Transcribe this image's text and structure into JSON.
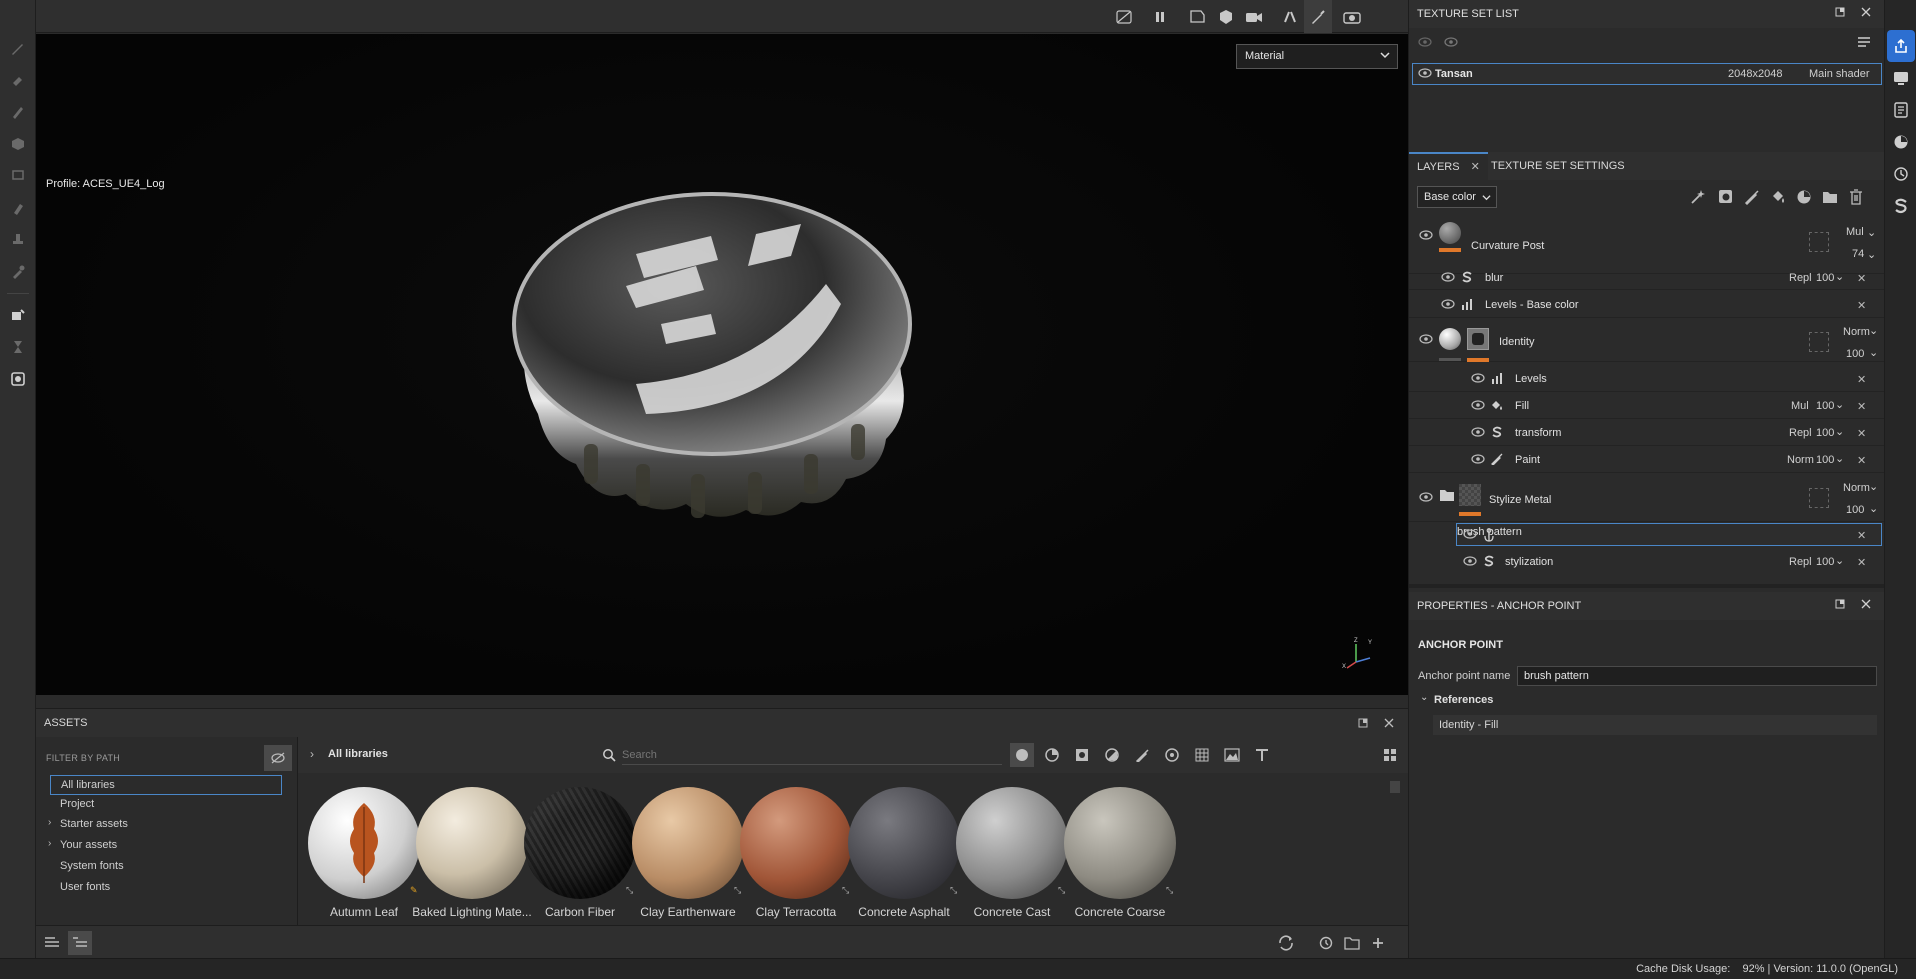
{
  "viewport": {
    "profile": "Profile: ACES_UE4_Log",
    "mode": "Material"
  },
  "texture_set_list": {
    "title": "TEXTURE SET LIST",
    "row": {
      "name": "Tansan",
      "resolution": "2048x2048",
      "shader": "Main shader"
    }
  },
  "layers_panel": {
    "tab_layers": "LAYERS",
    "tab_settings": "TEXTURE SET SETTINGS",
    "channel": "Base color",
    "layers": {
      "curvature": {
        "name": "Curvature Post",
        "blend": "Mul",
        "opacity": "74"
      },
      "blur": {
        "name": "blur",
        "blend": "Repl",
        "opacity": "100"
      },
      "levels_base": {
        "name": "Levels - Base color"
      },
      "identity": {
        "name": "Identity",
        "blend": "Norm",
        "opacity": "100"
      },
      "levels": {
        "name": "Levels"
      },
      "fill": {
        "name": "Fill",
        "blend": "Mul",
        "opacity": "100"
      },
      "transform": {
        "name": "transform",
        "blend": "Repl",
        "opacity": "100"
      },
      "paint": {
        "name": "Paint",
        "blend": "Norm",
        "opacity": "100"
      },
      "stylize": {
        "name": "Stylize Metal",
        "blend": "Norm",
        "opacity": "100"
      },
      "brush_pattern": {
        "name": "brush pattern"
      },
      "stylization": {
        "name": "stylization",
        "blend": "Repl",
        "opacity": "100"
      }
    }
  },
  "properties": {
    "title": "PROPERTIES - ANCHOR POINT",
    "section": "ANCHOR POINT",
    "field_label": "Anchor point name",
    "field_value": "brush pattern",
    "references_label": "References",
    "reference_item": "Identity - Fill"
  },
  "assets": {
    "title": "ASSETS",
    "filter_label": "FILTER BY PATH",
    "breadcrumb": "All libraries",
    "search_placeholder": "Search",
    "tree": [
      "All libraries",
      "Project",
      "Starter assets",
      "Your assets",
      "System fonts",
      "User fonts"
    ],
    "thumbnails": [
      {
        "name": "Autumn Leaf"
      },
      {
        "name": "Baked Lighting Mate..."
      },
      {
        "name": "Carbon Fiber"
      },
      {
        "name": "Clay Earthenware"
      },
      {
        "name": "Clay Terracotta"
      },
      {
        "name": "Concrete Asphalt"
      },
      {
        "name": "Concrete Cast"
      },
      {
        "name": "Concrete Coarse"
      }
    ]
  },
  "status": {
    "text": "Cache Disk Usage:    92% | Version: 11.0.0 (OpenGL)"
  },
  "colors": {
    "accent": "#4a86c7",
    "orange": "#e0782a",
    "active_strip": "#2d6fd1"
  }
}
